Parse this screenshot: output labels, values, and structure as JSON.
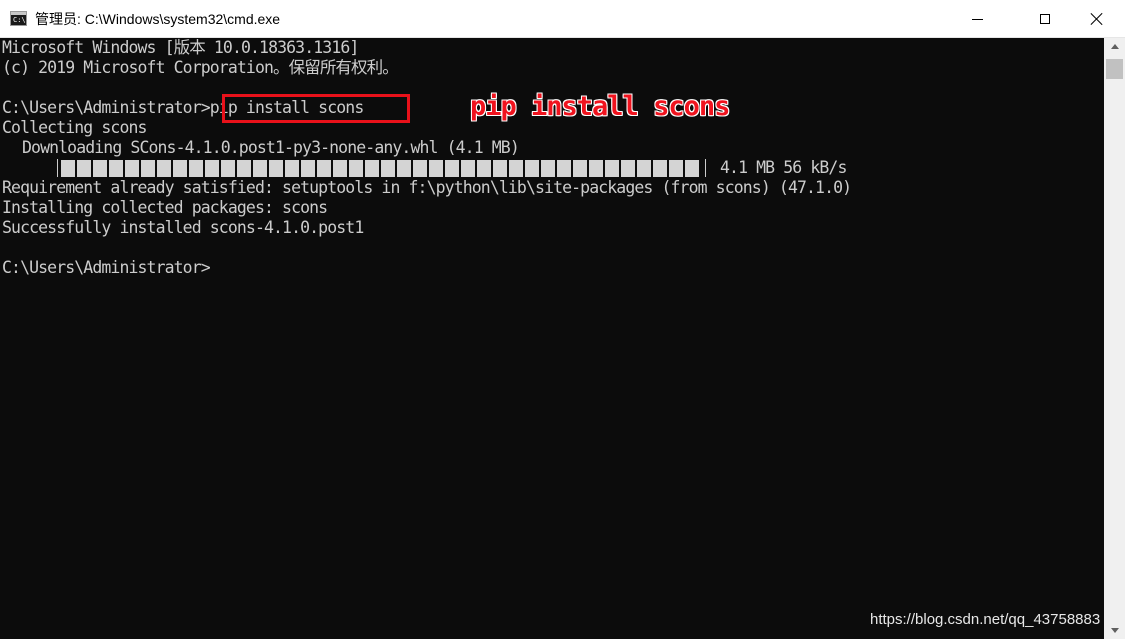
{
  "window": {
    "title": "管理员: C:\\Windows\\system32\\cmd.exe",
    "icon": "cmd-icon",
    "icon_glyph": "C:\\."
  },
  "console": {
    "lines": {
      "version": "Microsoft Windows [版本 10.0.18363.1316]",
      "copyright": "(c) 2019 Microsoft Corporation。保留所有权利。",
      "command": "C:\\Users\\Administrator>pip install scons",
      "collecting": "Collecting scons",
      "downloading": "Downloading SCons-4.1.0.post1-py3-none-any.whl (4.1 MB)",
      "requirement": "Requirement already satisfied: setuptools in f:\\python\\lib\\site-packages (from scons) (47.1.0)",
      "installing": "Installing collected packages: scons",
      "success": "Successfully installed scons-4.1.0.post1",
      "prompt": "C:\\Users\\Administrator>"
    },
    "progress": {
      "fraction": 1.0,
      "stats": "4.1 MB 56 kB/s"
    }
  },
  "annotation": {
    "text": "pip install scons",
    "color": "#f0131e"
  },
  "watermark": "https://blog.csdn.net/qq_43758883",
  "colors": {
    "console_bg": "#0c0c0c",
    "console_text": "#cccccc",
    "highlight": "#e8111a"
  }
}
